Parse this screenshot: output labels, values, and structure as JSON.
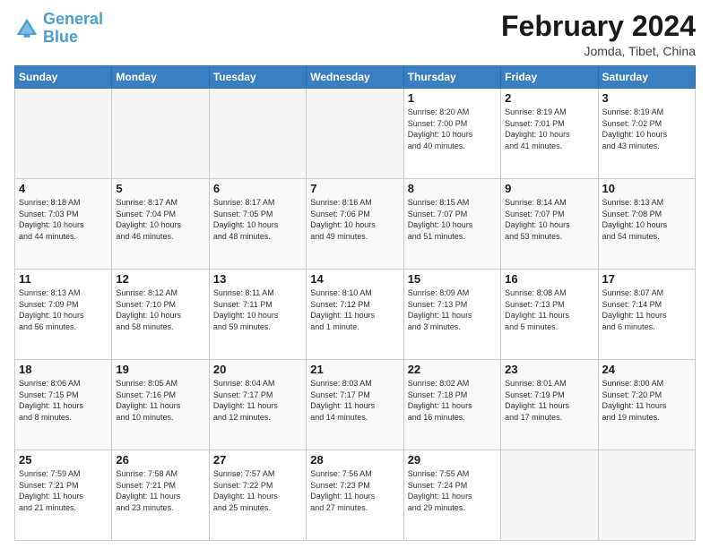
{
  "header": {
    "logo_line1": "General",
    "logo_line2": "Blue",
    "title": "February 2024",
    "subtitle": "Jomda, Tibet, China"
  },
  "weekdays": [
    "Sunday",
    "Monday",
    "Tuesday",
    "Wednesday",
    "Thursday",
    "Friday",
    "Saturday"
  ],
  "weeks": [
    [
      {
        "day": "",
        "info": ""
      },
      {
        "day": "",
        "info": ""
      },
      {
        "day": "",
        "info": ""
      },
      {
        "day": "",
        "info": ""
      },
      {
        "day": "1",
        "info": "Sunrise: 8:20 AM\nSunset: 7:00 PM\nDaylight: 10 hours\nand 40 minutes."
      },
      {
        "day": "2",
        "info": "Sunrise: 8:19 AM\nSunset: 7:01 PM\nDaylight: 10 hours\nand 41 minutes."
      },
      {
        "day": "3",
        "info": "Sunrise: 8:19 AM\nSunset: 7:02 PM\nDaylight: 10 hours\nand 43 minutes."
      }
    ],
    [
      {
        "day": "4",
        "info": "Sunrise: 8:18 AM\nSunset: 7:03 PM\nDaylight: 10 hours\nand 44 minutes."
      },
      {
        "day": "5",
        "info": "Sunrise: 8:17 AM\nSunset: 7:04 PM\nDaylight: 10 hours\nand 46 minutes."
      },
      {
        "day": "6",
        "info": "Sunrise: 8:17 AM\nSunset: 7:05 PM\nDaylight: 10 hours\nand 48 minutes."
      },
      {
        "day": "7",
        "info": "Sunrise: 8:16 AM\nSunset: 7:06 PM\nDaylight: 10 hours\nand 49 minutes."
      },
      {
        "day": "8",
        "info": "Sunrise: 8:15 AM\nSunset: 7:07 PM\nDaylight: 10 hours\nand 51 minutes."
      },
      {
        "day": "9",
        "info": "Sunrise: 8:14 AM\nSunset: 7:07 PM\nDaylight: 10 hours\nand 53 minutes."
      },
      {
        "day": "10",
        "info": "Sunrise: 8:13 AM\nSunset: 7:08 PM\nDaylight: 10 hours\nand 54 minutes."
      }
    ],
    [
      {
        "day": "11",
        "info": "Sunrise: 8:13 AM\nSunset: 7:09 PM\nDaylight: 10 hours\nand 56 minutes."
      },
      {
        "day": "12",
        "info": "Sunrise: 8:12 AM\nSunset: 7:10 PM\nDaylight: 10 hours\nand 58 minutes."
      },
      {
        "day": "13",
        "info": "Sunrise: 8:11 AM\nSunset: 7:11 PM\nDaylight: 10 hours\nand 59 minutes."
      },
      {
        "day": "14",
        "info": "Sunrise: 8:10 AM\nSunset: 7:12 PM\nDaylight: 11 hours\nand 1 minute."
      },
      {
        "day": "15",
        "info": "Sunrise: 8:09 AM\nSunset: 7:13 PM\nDaylight: 11 hours\nand 3 minutes."
      },
      {
        "day": "16",
        "info": "Sunrise: 8:08 AM\nSunset: 7:13 PM\nDaylight: 11 hours\nand 5 minutes."
      },
      {
        "day": "17",
        "info": "Sunrise: 8:07 AM\nSunset: 7:14 PM\nDaylight: 11 hours\nand 6 minutes."
      }
    ],
    [
      {
        "day": "18",
        "info": "Sunrise: 8:06 AM\nSunset: 7:15 PM\nDaylight: 11 hours\nand 8 minutes."
      },
      {
        "day": "19",
        "info": "Sunrise: 8:05 AM\nSunset: 7:16 PM\nDaylight: 11 hours\nand 10 minutes."
      },
      {
        "day": "20",
        "info": "Sunrise: 8:04 AM\nSunset: 7:17 PM\nDaylight: 11 hours\nand 12 minutes."
      },
      {
        "day": "21",
        "info": "Sunrise: 8:03 AM\nSunset: 7:17 PM\nDaylight: 11 hours\nand 14 minutes."
      },
      {
        "day": "22",
        "info": "Sunrise: 8:02 AM\nSunset: 7:18 PM\nDaylight: 11 hours\nand 16 minutes."
      },
      {
        "day": "23",
        "info": "Sunrise: 8:01 AM\nSunset: 7:19 PM\nDaylight: 11 hours\nand 17 minutes."
      },
      {
        "day": "24",
        "info": "Sunrise: 8:00 AM\nSunset: 7:20 PM\nDaylight: 11 hours\nand 19 minutes."
      }
    ],
    [
      {
        "day": "25",
        "info": "Sunrise: 7:59 AM\nSunset: 7:21 PM\nDaylight: 11 hours\nand 21 minutes."
      },
      {
        "day": "26",
        "info": "Sunrise: 7:58 AM\nSunset: 7:21 PM\nDaylight: 11 hours\nand 23 minutes."
      },
      {
        "day": "27",
        "info": "Sunrise: 7:57 AM\nSunset: 7:22 PM\nDaylight: 11 hours\nand 25 minutes."
      },
      {
        "day": "28",
        "info": "Sunrise: 7:56 AM\nSunset: 7:23 PM\nDaylight: 11 hours\nand 27 minutes."
      },
      {
        "day": "29",
        "info": "Sunrise: 7:55 AM\nSunset: 7:24 PM\nDaylight: 11 hours\nand 29 minutes."
      },
      {
        "day": "",
        "info": ""
      },
      {
        "day": "",
        "info": ""
      }
    ]
  ]
}
